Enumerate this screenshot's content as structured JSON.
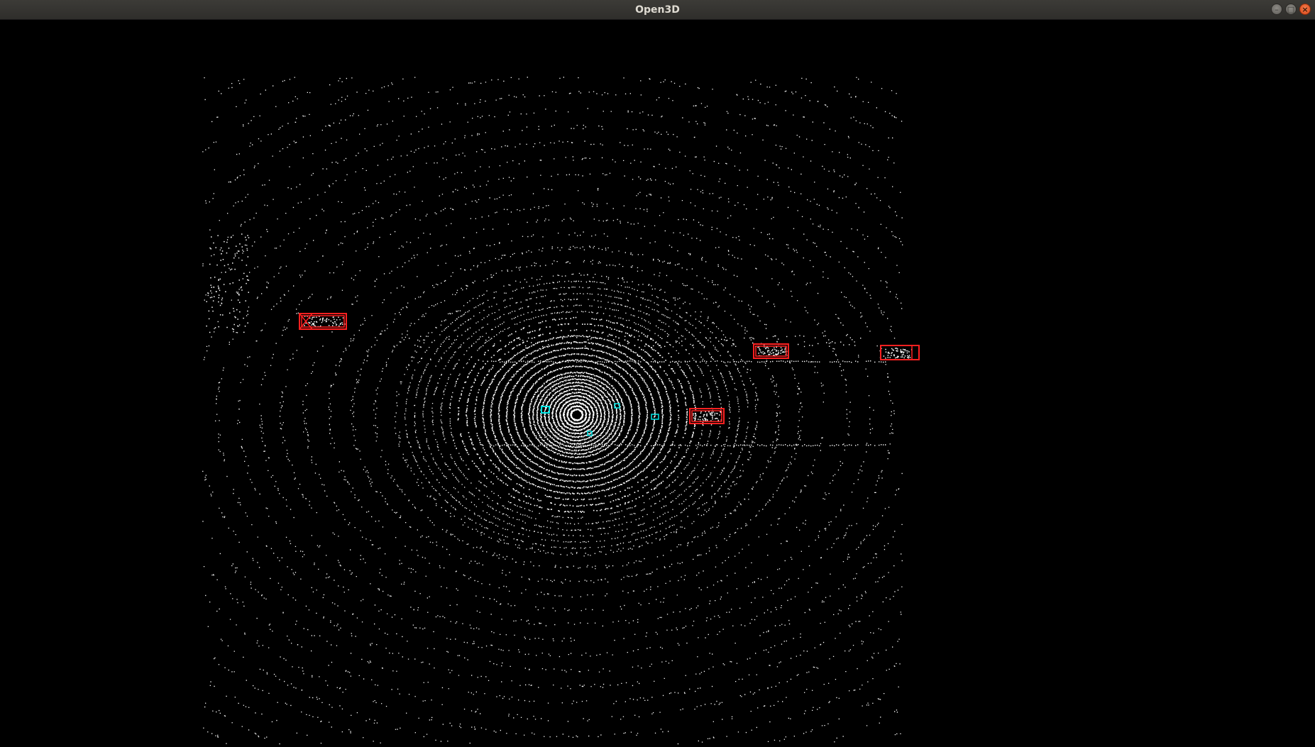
{
  "window": {
    "title": "Open3D"
  },
  "controls": {
    "minimize_icon": "minimize-icon",
    "maximize_icon": "maximize-icon",
    "close_icon": "close-icon",
    "minimize_glyph": "–",
    "maximize_glyph": "□",
    "close_glyph": "×"
  },
  "scene": {
    "background_color": "#000000",
    "point_color": "#ffffff",
    "vehicle_box_color": "#ff0000",
    "pedestrian_box_color": "#00e5e5",
    "vehicle_boxes": 5,
    "pedestrian_boxes": 4
  }
}
